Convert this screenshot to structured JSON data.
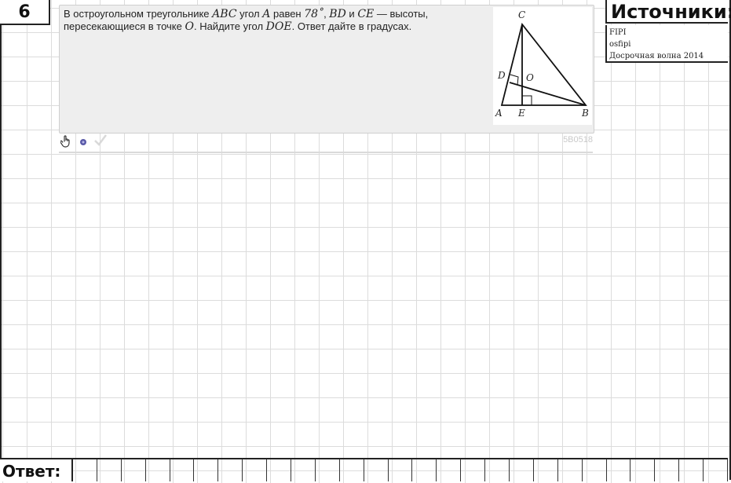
{
  "task_number": "6",
  "task": {
    "text_parts": [
      "В остроугольном треугольнике ",
      "ABC",
      " угол ",
      "A",
      " равен ",
      "78˚",
      ", ",
      "BD",
      " и ",
      "CE",
      " — высоты, пересекающиеся в точке ",
      "O",
      ". Найдите угол ",
      "DOE",
      ". Ответ дайте в градусах."
    ],
    "figure_labels": {
      "A": "A",
      "B": "B",
      "C": "C",
      "D": "D",
      "E": "E",
      "O": "O"
    },
    "task_id": "5B0518"
  },
  "toolbar": {
    "hand_icon": "hand-pointer-icon",
    "dot_icon": "circle-icon",
    "check_icon": "checkmark-icon"
  },
  "sources": {
    "title": "Источники:",
    "items": [
      "FIPI",
      "osfipi",
      "Досрочная волна 2014"
    ]
  },
  "answer": {
    "label": "Ответ:"
  }
}
